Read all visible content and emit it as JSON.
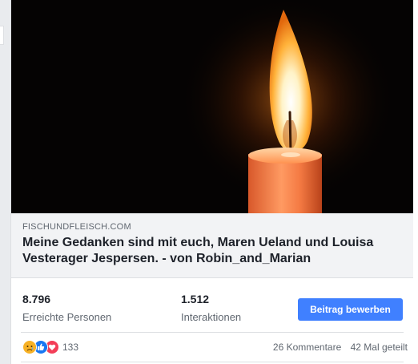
{
  "post": {
    "image_description_icon": "candle-image",
    "link": {
      "domain": "FISCHUNDFLEISCH.COM",
      "title": "Meine Gedanken sind mit euch, Maren Ueland und Louisa Vesterager Jespersen. - von Robin_and_Marian"
    },
    "stats": {
      "reach_value": "8.796",
      "reach_label": "Erreichte Personen",
      "engagement_value": "1.512",
      "engagement_label": "Interaktionen"
    },
    "boost_button_label": "Beitrag bewerben",
    "reactions": {
      "icons": [
        "sad-reaction-icon",
        "like-reaction-icon",
        "love-reaction-icon"
      ],
      "count": "133"
    },
    "comments_text": "26 Kommentare",
    "shares_text": "42 Mal geteilt"
  },
  "colors": {
    "boost_button": "#4080ff",
    "like": "#1877f2",
    "love": "#f33e58",
    "sad": "#f7b125"
  }
}
